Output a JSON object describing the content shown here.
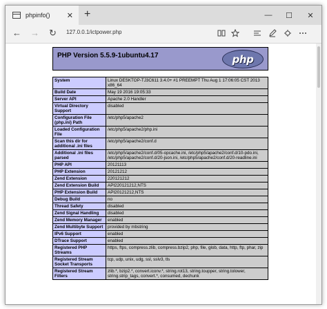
{
  "browser": {
    "tab_title": "phpinfo()",
    "tab_close": "✕",
    "new_tab": "+",
    "controls": {
      "minimize": "—",
      "maximize": "☐",
      "close": "✕"
    },
    "address": "127.0.0.1/ictpower.php",
    "nav": {
      "back": "←",
      "forward": "→",
      "refresh": "↻"
    },
    "toolbar_icons": [
      "reading-view-icon",
      "favorite-star-icon",
      "hub-icon",
      "notes-icon",
      "share-icon",
      "more-icon"
    ]
  },
  "php": {
    "title": "PHP Version 5.5.9-1ubuntu4.17",
    "logo_text": "php",
    "colors": {
      "header_bg": "#9999cc",
      "key_bg": "#ccccff",
      "value_bg": "#cccccc"
    },
    "rows": [
      {
        "key": "System",
        "value": "Linux DESKTOP-TJ3C611 3.4.0+ #1 PREEMPT Thu Aug 1 17:06:05 CST 2013 x86_64"
      },
      {
        "key": "Build Date",
        "value": "May 19 2016 19:05:33"
      },
      {
        "key": "Server API",
        "value": "Apache 2.0 Handler"
      },
      {
        "key": "Virtual Directory Support",
        "value": "disabled"
      },
      {
        "key": "Configuration File (php.ini) Path",
        "value": "/etc/php5/apache2"
      },
      {
        "key": "Loaded Configuration File",
        "value": "/etc/php5/apache2/php.ini"
      },
      {
        "key": "Scan this dir for additional .ini files",
        "value": "/etc/php5/apache2/conf.d"
      },
      {
        "key": "Additional .ini files parsed",
        "value": "/etc/php5/apache2/conf.d/05-opcache.ini, /etc/php5/apache2/conf.d/10-pdo.ini, /etc/php5/apache2/conf.d/20-json.ini, /etc/php5/apache2/conf.d/20-readline.ini"
      },
      {
        "key": "PHP API",
        "value": "20121113"
      },
      {
        "key": "PHP Extension",
        "value": "20121212"
      },
      {
        "key": "Zend Extension",
        "value": "220121212"
      },
      {
        "key": "Zend Extension Build",
        "value": "API220121212,NTS"
      },
      {
        "key": "PHP Extension Build",
        "value": "API20121212,NTS"
      },
      {
        "key": "Debug Build",
        "value": "no"
      },
      {
        "key": "Thread Safety",
        "value": "disabled"
      },
      {
        "key": "Zend Signal Handling",
        "value": "disabled"
      },
      {
        "key": "Zend Memory Manager",
        "value": "enabled"
      },
      {
        "key": "Zend Multibyte Support",
        "value": "provided by mbstring"
      },
      {
        "key": "IPv6 Support",
        "value": "enabled"
      },
      {
        "key": "DTrace Support",
        "value": "enabled"
      },
      {
        "key": "Registered PHP Streams",
        "value": "https, ftps, compress.zlib, compress.bzip2, php, file, glob, data, http, ftp, phar, zip"
      },
      {
        "key": "Registered Stream Socket Transports",
        "value": "tcp, udp, unix, udg, ssl, sslv3, tls"
      },
      {
        "key": "Registered Stream Filters",
        "value": "zlib.*, bzip2.*, convert.iconv.*, string.rot13, string.toupper, string.tolower, string.strip_tags, convert.*, consumed, dechunk"
      }
    ]
  }
}
